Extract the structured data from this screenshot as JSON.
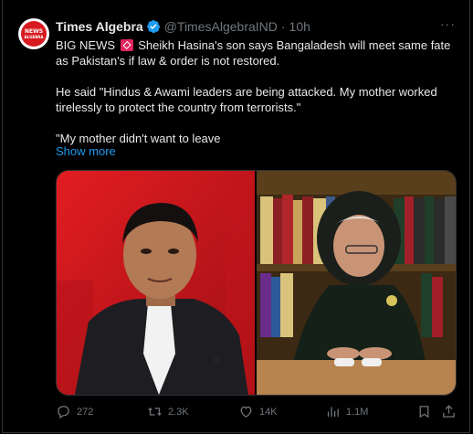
{
  "account": {
    "name": "Times Algebra",
    "handle": "@TimesAlgebraIND",
    "separator": "·",
    "time": "10h",
    "avatar_text": "NEWS",
    "avatar_subtext": "ALGEBRA"
  },
  "tweet": {
    "line1_before": "BIG NEWS",
    "line1_after": "Sheikh Hasina's son says Bangaladesh will meet same fate as Pakistan's if law & order is not restored.",
    "para2": "He said \"Hindus & Awami leaders are being attacked. My mother worked tirelessly to protect the country from terrorists.\"",
    "para3": "\"My mother didn't want to leave",
    "show_more": "Show more"
  },
  "actions": {
    "replies": "272",
    "reposts": "2.3K",
    "likes": "14K",
    "views": "1.1M"
  },
  "colors": {
    "background": "#000000",
    "text": "#e7e9ea",
    "muted": "#71767b",
    "link": "#1d9bf0",
    "verified": "#1d9bf0",
    "border": "#2f3336"
  }
}
